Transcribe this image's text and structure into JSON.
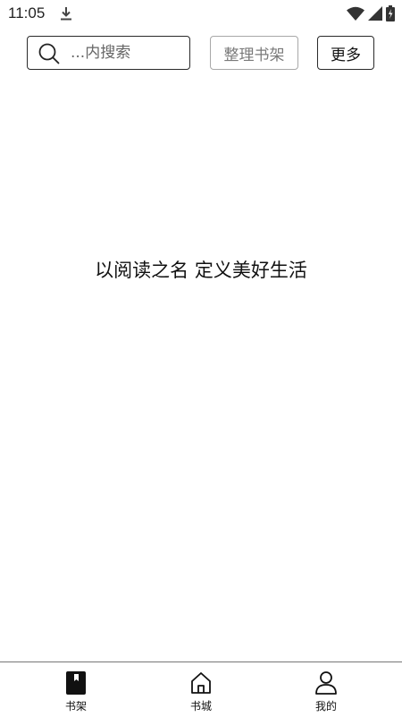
{
  "status_bar": {
    "time": "11:05",
    "icons": [
      "download-icon",
      "wifi-icon",
      "signal-icon",
      "battery-icon"
    ]
  },
  "header": {
    "search": {
      "placeholder": "...内搜索",
      "icon": "search-icon"
    },
    "organize_label": "整理书架",
    "more_label": "更多"
  },
  "main": {
    "slogan": "以阅读之名 定义美好生活"
  },
  "tabbar": {
    "items": [
      {
        "label": "书架",
        "icon": "book-icon",
        "active": true
      },
      {
        "label": "书城",
        "icon": "home-icon",
        "active": false
      },
      {
        "label": "我的",
        "icon": "person-icon",
        "active": false
      }
    ]
  },
  "colors": {
    "border": "#2a2a2a",
    "disabled_border": "#a8a8a8",
    "disabled_text": "#7a7a7a",
    "background": "#ffffff"
  }
}
